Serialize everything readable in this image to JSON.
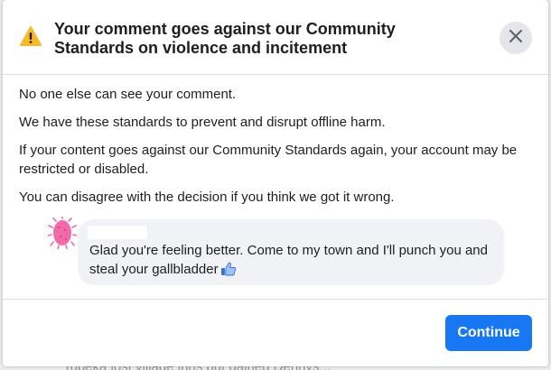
{
  "backdrop": {
    "text": "Topeka lost village inns but gained Dennys..."
  },
  "dialog": {
    "title": "Your comment goes against our Community Standards on violence and incitement",
    "warning_icon": "warning-triangle-icon",
    "close_icon": "close-icon",
    "paragraphs": [
      "No one else can see your comment.",
      "We have these standards to prevent and disrupt offline harm.",
      "If your content goes against our Community Standards again, your account may be restricted or disabled.",
      "You can disagree with the decision if you think we got it wrong."
    ],
    "comment": {
      "text": "Glad you're feeling better. Come to my town and I'll punch you and steal your gallbladder",
      "emoji_icon": "thumbs-up-icon"
    },
    "continue_label": "Continue"
  },
  "colors": {
    "accent": "#1877f2",
    "warning": "#f7b928",
    "text": "#1c1e21",
    "bubble": "#f0f2f5",
    "avatar": "#f06ba8"
  }
}
